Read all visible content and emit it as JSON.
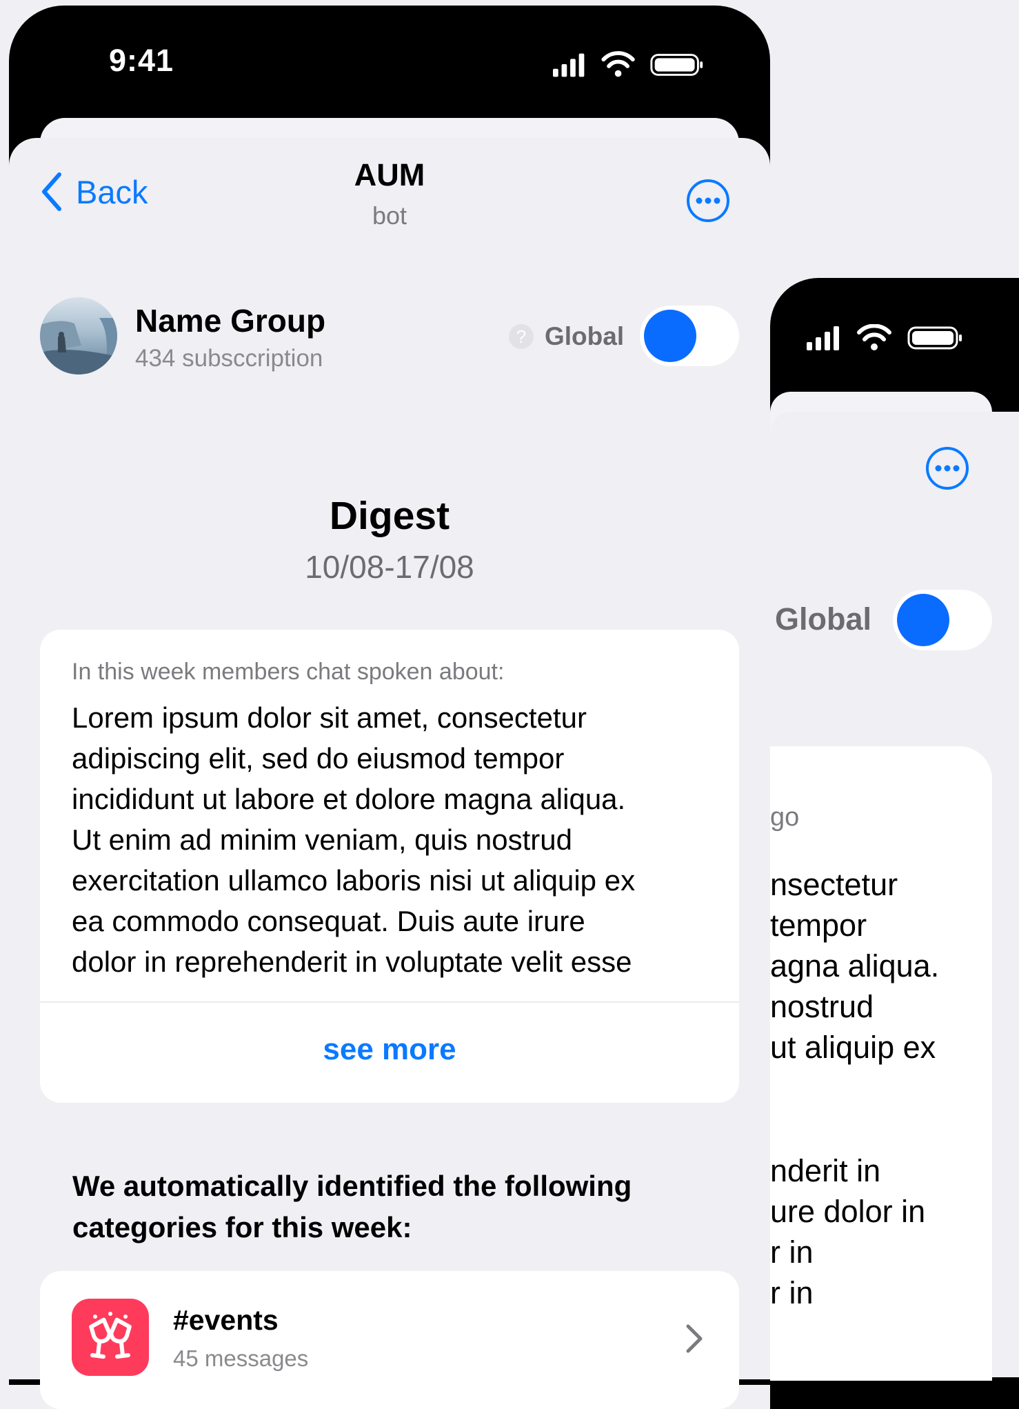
{
  "status_bar": {
    "time": "9:41"
  },
  "nav": {
    "back_label": "Back",
    "title": "AUM",
    "subtitle": "bot"
  },
  "group": {
    "name": "Name Group",
    "subscriptions": "434 subsccription",
    "help_glyph": "?",
    "global_label": "Global",
    "global_enabled": true
  },
  "digest": {
    "title": "Digest",
    "date_range": "10/08-17/08",
    "caption": "In this week members chat spoken about:",
    "lines": [
      "Lorem ipsum dolor sit amet, consectetur",
      "adipiscing elit, sed do eiusmod tempor",
      "incididunt ut labore et dolore magna aliqua.",
      "Ut enim ad minim veniam, quis nostrud",
      "exercitation ullamco laboris nisi ut aliquip ex",
      "ea commodo consequat. Duis aute irure",
      "dolor in reprehenderit in voluptate velit esse"
    ],
    "see_more": "see more"
  },
  "categories": {
    "heading_lines": [
      "We automatically identified the following",
      "categories for this week:"
    ],
    "items": [
      {
        "name": "#events",
        "count": "45 messages",
        "icon": "toast-icon"
      }
    ]
  },
  "back_screen": {
    "global_label": "Global",
    "fragments": [
      "go",
      "nsectetur",
      "tempor",
      "agna aliqua.",
      "nostrud",
      "ut aliquip ex",
      "nderit in",
      "ure dolor in",
      "r in",
      "r in"
    ]
  },
  "colors": {
    "accent": "#0A7AFF",
    "toggle_knob": "#0A6CFF",
    "category_icon": "#FF3B5C",
    "background": "#EFEFF4"
  }
}
